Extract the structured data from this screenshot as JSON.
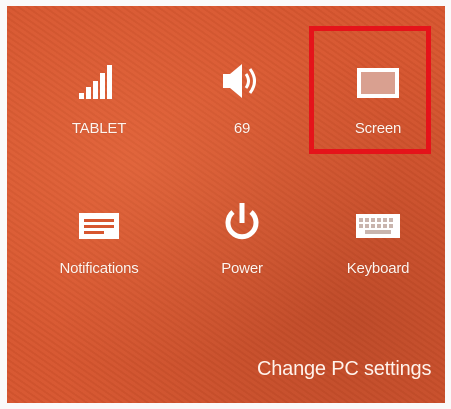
{
  "tiles": {
    "network": {
      "label": "TABLET",
      "icon": "signal-bars-icon"
    },
    "volume": {
      "label": "69",
      "icon": "speaker-volume-icon"
    },
    "screen": {
      "label": "Screen",
      "icon": "screen-brightness-icon"
    },
    "notifications": {
      "label": "Notifications",
      "icon": "notifications-icon"
    },
    "power": {
      "label": "Power",
      "icon": "power-icon"
    },
    "keyboard": {
      "label": "Keyboard",
      "icon": "keyboard-icon"
    }
  },
  "footer": {
    "change_pc_settings": "Change PC settings"
  },
  "colors": {
    "background": "#d7562f",
    "highlight_border": "#e5131a",
    "screen_icon_fill": "#d9a090",
    "text": "#ffffff"
  }
}
